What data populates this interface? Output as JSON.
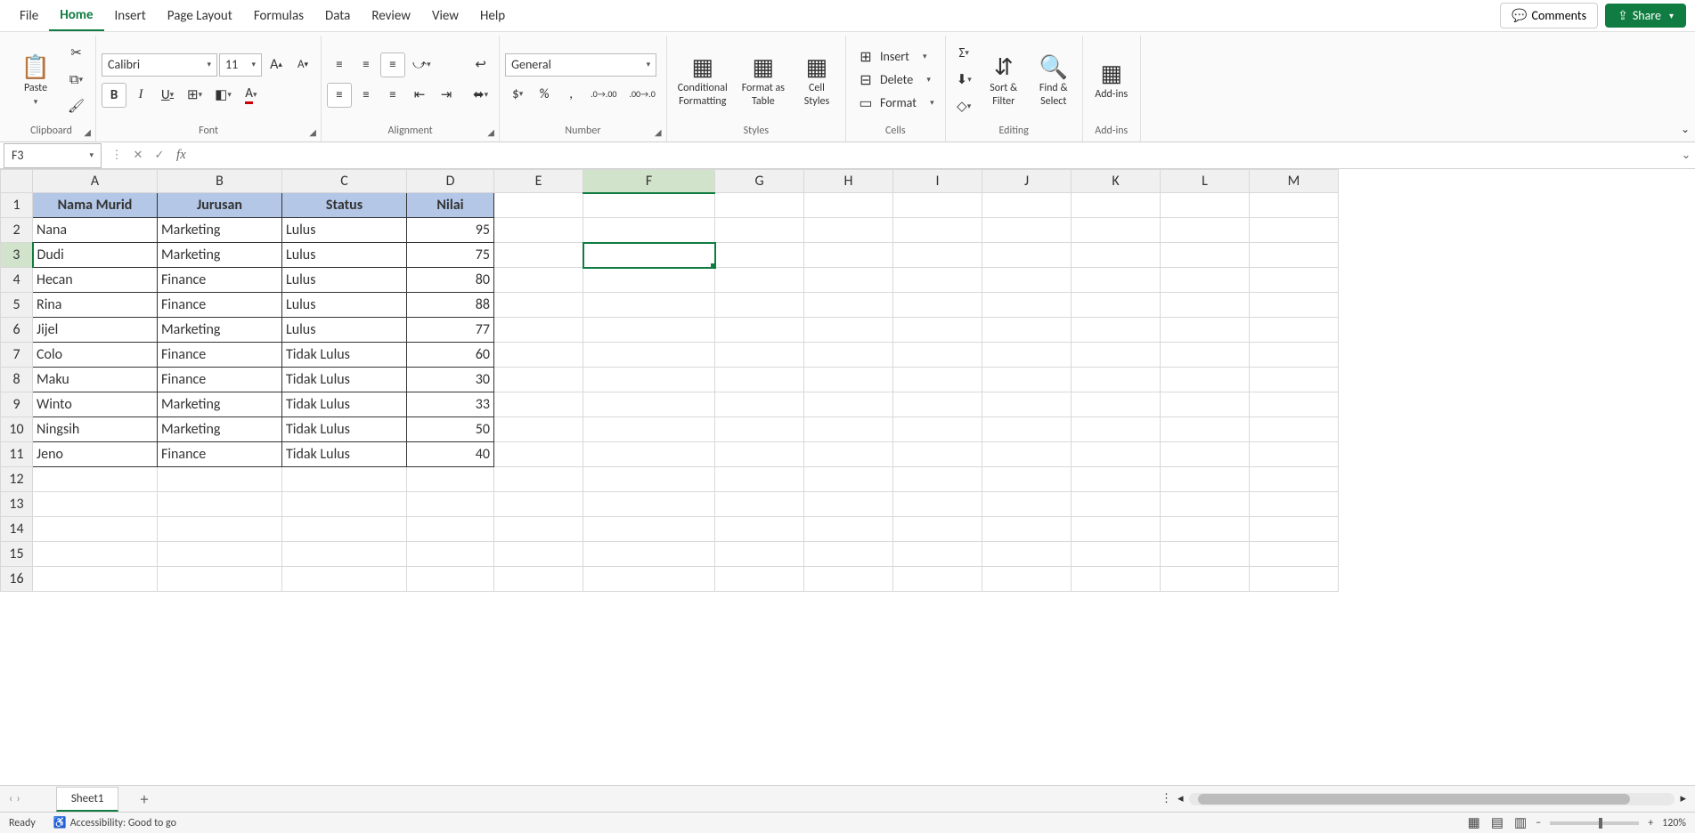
{
  "menu": {
    "file": "File",
    "home": "Home",
    "insert": "Insert",
    "page_layout": "Page Layout",
    "formulas": "Formulas",
    "data": "Data",
    "review": "Review",
    "view": "View",
    "help": "Help"
  },
  "topright": {
    "comments": "Comments",
    "share": "Share"
  },
  "ribbon": {
    "clipboard": {
      "label": "Clipboard",
      "paste": "Paste"
    },
    "font": {
      "label": "Font",
      "name": "Calibri",
      "size": "11",
      "bold": "B",
      "italic": "I",
      "underline": "U"
    },
    "alignment": {
      "label": "Alignment"
    },
    "number": {
      "label": "Number",
      "format": "General"
    },
    "styles": {
      "label": "Styles",
      "cond": "Conditional\nFormatting",
      "table": "Format as\nTable",
      "cell": "Cell\nStyles"
    },
    "cells": {
      "label": "Cells",
      "insert": "Insert",
      "delete": "Delete",
      "format": "Format"
    },
    "editing": {
      "label": "Editing",
      "sort": "Sort &\nFilter",
      "find": "Find &\nSelect"
    },
    "addins": {
      "label": "Add-ins",
      "btn": "Add-ins"
    }
  },
  "namebox": "F3",
  "columns": [
    "A",
    "B",
    "C",
    "D",
    "E",
    "F",
    "G",
    "H",
    "I",
    "J",
    "K",
    "L",
    "M"
  ],
  "rows": 16,
  "table": {
    "headers": [
      "Nama Murid",
      "Jurusan",
      "Status",
      "Nilai"
    ],
    "data": [
      [
        "Nana",
        "Marketing",
        "Lulus",
        "95"
      ],
      [
        "Dudi",
        "Marketing",
        "Lulus",
        "75"
      ],
      [
        "Hecan",
        "Finance",
        "Lulus",
        "80"
      ],
      [
        "Rina",
        "Finance",
        "Lulus",
        "88"
      ],
      [
        "Jijel",
        "Marketing",
        "Lulus",
        "77"
      ],
      [
        "Colo",
        "Finance",
        "Tidak Lulus",
        "60"
      ],
      [
        "Maku",
        "Finance",
        "Tidak Lulus",
        "30"
      ],
      [
        "Winto",
        "Marketing",
        "Tidak Lulus",
        "33"
      ],
      [
        "Ningsih",
        "Marketing",
        "Tidak Lulus",
        "50"
      ],
      [
        "Jeno",
        "Finance",
        "Tidak Lulus",
        "40"
      ]
    ]
  },
  "active_cell": {
    "col": "F",
    "row": 3
  },
  "sheet": {
    "name": "Sheet1"
  },
  "status": {
    "ready": "Ready",
    "acc": "Accessibility: Good to go",
    "zoom": "120%"
  }
}
